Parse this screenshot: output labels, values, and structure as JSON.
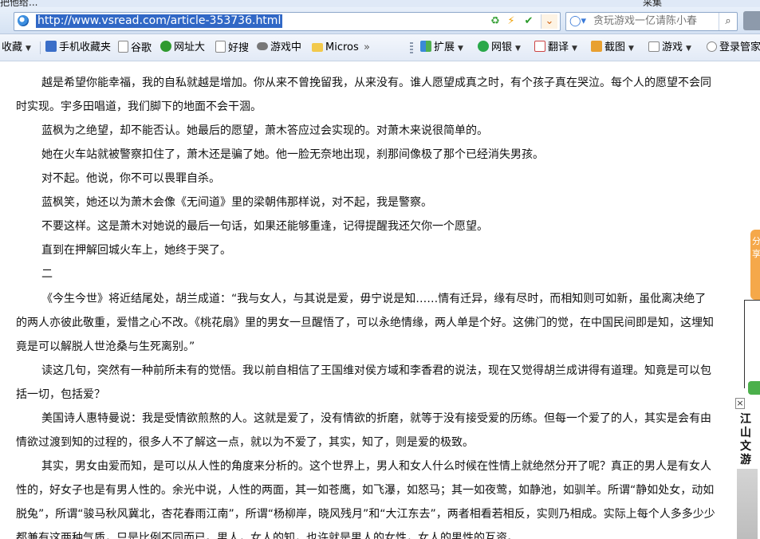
{
  "title_bar": {
    "left_text": "把他给...",
    "right_text": "采集"
  },
  "address_bar": {
    "url": "http://www.vsread.com/article-353736.html"
  },
  "search": {
    "placeholder": "贪玩游戏一亿请陈小春"
  },
  "favorites": [
    {
      "label": "收藏",
      "icon": "folder-icon"
    },
    {
      "label": "手机收藏夹",
      "icon": "phone-icon"
    },
    {
      "label": "谷歌",
      "icon": "page-icon"
    },
    {
      "label": "网址大",
      "icon": "web-nav-icon"
    },
    {
      "label": "好搜",
      "icon": "page-icon"
    },
    {
      "label": "游戏中",
      "icon": "gamepad-icon"
    },
    {
      "label": "Micros",
      "icon": "folder-icon"
    },
    {
      "label": "»",
      "icon": "chevron-icon"
    },
    {
      "label": "扩展",
      "icon": "extension-icon"
    },
    {
      "label": "网银",
      "icon": "bank-icon"
    },
    {
      "label": "翻译",
      "icon": "translate-icon"
    },
    {
      "label": "截图",
      "icon": "scissors-icon"
    },
    {
      "label": "游戏",
      "icon": "game-icon"
    },
    {
      "label": "登录管家",
      "icon": "key-icon"
    }
  ],
  "article": {
    "lines": [
      "越是希望你能幸福，我的自私就越是增加。你从来不曾挽留我，从来没有。谁人愿望成真之时，有个孩子真在哭泣。每个人的愿望不会同时实现。宇多田唱道，我们脚下的地面不会干涸。",
      "蓝枫为之绝望，却不能否认。她最后的愿望，萧木答应过会实现的。对萧木来说很简单的。",
      "她在火车站就被警察扣住了，萧木还是骗了她。他一脸无奈地出现，刹那间像极了那个已经消失男孩。",
      "对不起。他说，你不可以畏罪自杀。",
      "蓝枫笑，她还以为萧木会像《无间道》里的梁朝伟那样说，对不起，我是警察。",
      "不要这样。这是萧木对她说的最后一句话，如果还能够重逢，记得提醒我还欠你一个愿望。",
      "直到在押解回城火车上，她终于哭了。",
      "二",
      "《今生今世》将近结尾处，胡兰成道：“我与女人，与其说是爱，毋宁说是知……情有迁异，缘有尽时，而相知则可如新，虽仳离决绝了的两人亦彼此敬重，爱惜之心不改。《桃花扇》里的男女一旦醒悟了，可以永绝情缘，两人单是个好。这佛门的觉，在中国民间即是知，这埋知竟是可以解脱人世沧桑与生死离别。”",
      "读这几句，突然有一种前所未有的觉悟。我以前自相信了王国维对侯方域和李香君的说法，现在又觉得胡兰成讲得有道理。知竟是可以包括一切，包括爱？",
      "美国诗人惠特曼说：我是受情欲煎熬的人。这就是爱了，没有情欲的折磨，就等于没有接受爱的历练。但每一个爱了的人，其实是会有由情欲过渡到知的过程的，很多人不了解这一点，就以为不爱了，其实，知了，则是爱的极致。",
      "其实，男女由爱而知，是可以从人性的角度来分析的。这个世界上，男人和女人什么时候在性情上就绝然分开了呢？真正的男人是有女人性的，好女子也是有男人性的。余光中说，人性的两面，其一如苍鹰，如飞瀑，如怒马；其一如夜莺，如静池，如驯羊。所谓“静如处女，动如脱兔”，所谓“骏马秋风冀北，杏花春雨江南”，所谓“杨柳岸，晓风残月”和“大江东去”，两者相看若相反，实则乃相成。实际上每个人多多少少都兼有这两种气质，只是比例不同而已。男人，女人的知，也许就是男人的女性，女人的男性的互资。"
    ]
  },
  "side_panel": {
    "orange_tab_text": "分享",
    "brand_text": "江山文游",
    "close_glyph": "×"
  }
}
